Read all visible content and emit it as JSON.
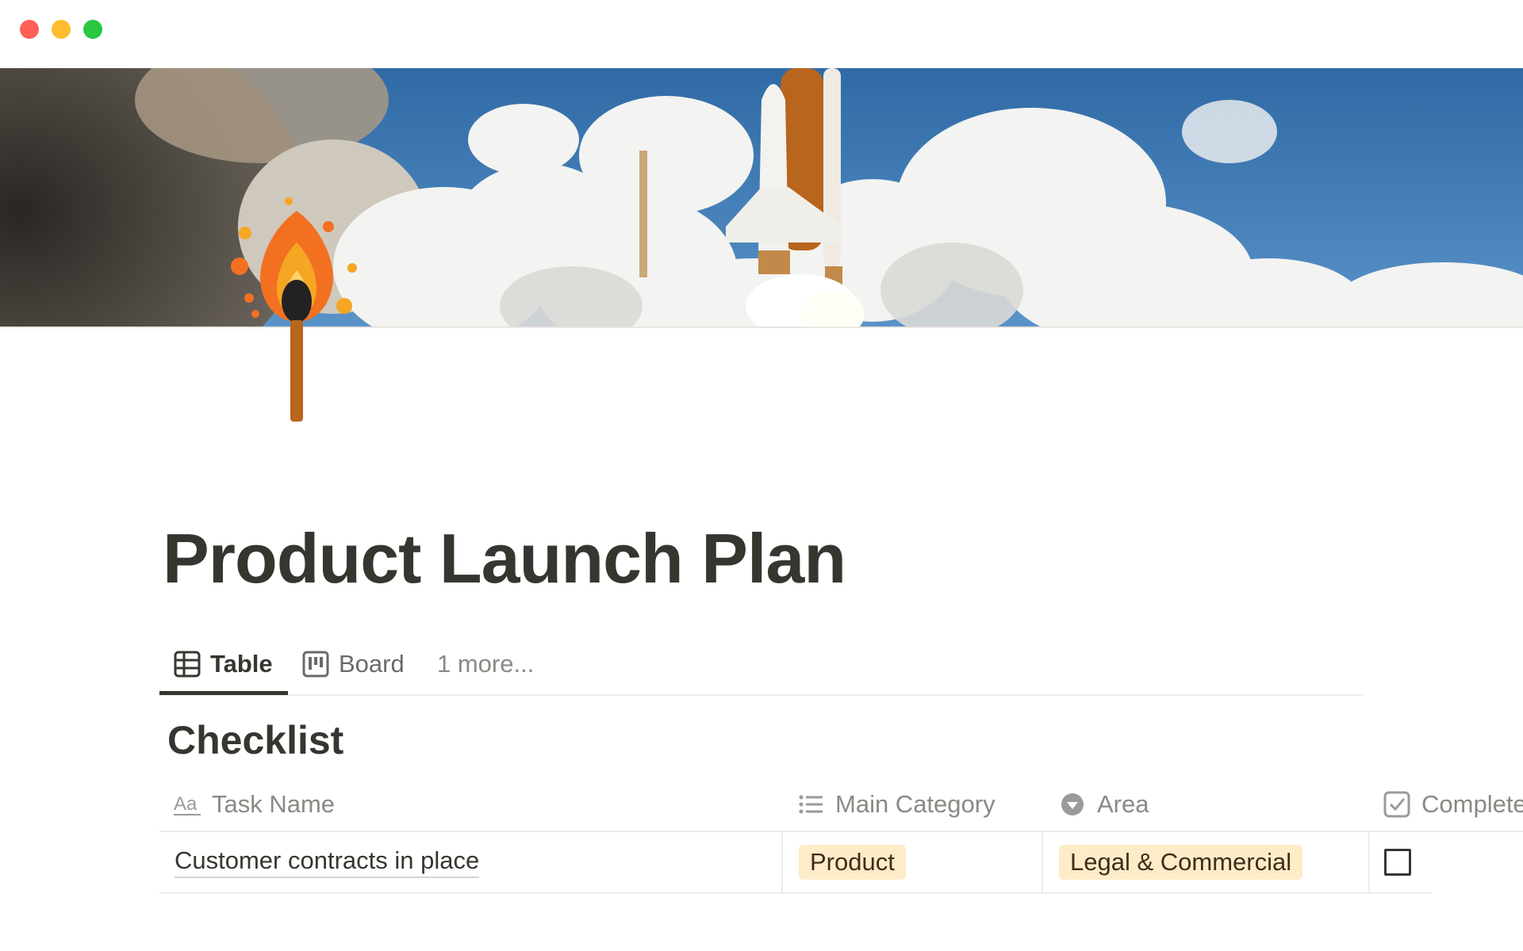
{
  "window": {
    "controls": [
      "close",
      "minimize",
      "maximize"
    ],
    "colors": {
      "close": "#ff5f57",
      "minimize": "#febc2e",
      "maximize": "#28c840"
    }
  },
  "cover": {
    "icon": "space-shuttle-launch-cover",
    "sky_color": "#3f78b3"
  },
  "page": {
    "icon": "match-flame-icon",
    "title": "Product Launch Plan"
  },
  "views": {
    "tabs": [
      {
        "label": "Table",
        "icon": "table-icon",
        "active": true
      },
      {
        "label": "Board",
        "icon": "board-icon",
        "active": false
      }
    ],
    "more_label": "1 more..."
  },
  "checklist": {
    "title": "Checklist",
    "columns": [
      {
        "label": "Task Name",
        "icon": "text-property-icon"
      },
      {
        "label": "Main Category",
        "icon": "list-property-icon"
      },
      {
        "label": "Area",
        "icon": "select-property-icon"
      },
      {
        "label": "Complete",
        "icon": "checkbox-property-icon"
      }
    ],
    "rows": [
      {
        "task": "Customer contracts in place",
        "category": "Product",
        "area": "Legal & Commercial",
        "complete": false
      }
    ],
    "tag_color": "#fdecc8"
  }
}
